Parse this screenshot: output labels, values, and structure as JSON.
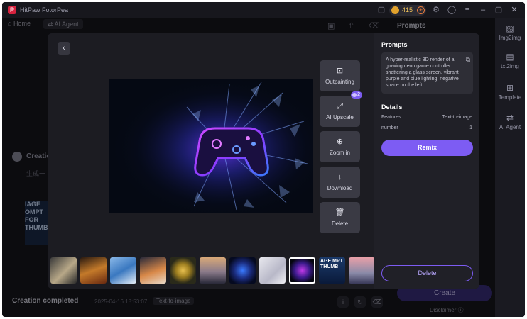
{
  "app": {
    "title": "HitPaw FotorPea",
    "credits": "415"
  },
  "background": {
    "home_label": "Home",
    "agent_label": "AI Agent",
    "prompts_title": "Prompts",
    "rail": [
      {
        "label": "Img2img"
      },
      {
        "label": "txt2img"
      },
      {
        "label": "Template"
      },
      {
        "label": "AI Agent"
      }
    ],
    "creation_title": "Creation",
    "creation_sub": "生成一",
    "bottom_title": "Creation completed",
    "bottom_meta": "2025-04-16 18:53:07",
    "bottom_tag": "Text-to-image",
    "create_label": "Create",
    "disclaimer_label": "Disclaimer"
  },
  "viewer": {
    "back_icon": "back-icon",
    "tools": [
      {
        "label": "Outpainting",
        "icon": "outpainting-icon"
      },
      {
        "label": "AI Upscale",
        "icon": "upscale-icon"
      },
      {
        "label": "Zoom in",
        "icon": "zoom-in-icon"
      },
      {
        "label": "Download",
        "icon": "download-icon"
      },
      {
        "label": "Delete",
        "icon": "trash-icon"
      }
    ],
    "upscale_badge": "2",
    "thumbnails": [
      {
        "style": "linear-gradient(135deg,#3a3a3a,#b8a888 55%,#2a2a2a)"
      },
      {
        "style": "linear-gradient(160deg,#2a1a10,#c47a2a 50%,#6a2a10)"
      },
      {
        "style": "linear-gradient(150deg,#8ab8e8,#3a78c0 50%,#e8f0f8)"
      },
      {
        "style": "linear-gradient(160deg,#2a2a3a,#d88848 55%,#e8d8c8)"
      },
      {
        "style": "radial-gradient(circle,#e8c050 0%,#a08020 35%,#2a2a1a 70%)"
      },
      {
        "style": "linear-gradient(180deg,#d8a878,#8a7a8a 55%,#2a2a3a)"
      },
      {
        "style": "radial-gradient(circle,#3a7aff 0%,#1a2a7a 45%,#050a20 80%)"
      },
      {
        "style": "linear-gradient(135deg,#e8e8ee,#b8b8c8 60%,#f0f0f4)"
      },
      {
        "style": "radial-gradient(circle,#c03ae8 0%,#3a1a8a 45%,#05060f 80%)",
        "selected": true
      },
      {
        "style": "linear-gradient(180deg,#1b3a6a,#0a1a3a)",
        "text": "AGE MPT THUMB"
      },
      {
        "style": "linear-gradient(180deg,#e8a0a8,#8a8aa8 60%,#3a3a5a)"
      }
    ]
  },
  "panel": {
    "prompts_title": "Prompts",
    "prompt_text": "A hyper-realistic 3D render of a glowing neon game controller shattering a glass screen, vibrant purple and blue lighting, negative space on the left.",
    "details_title": "Details",
    "features_label": "Features",
    "features_value": "Text-to-image",
    "number_label": "number",
    "number_value": "1",
    "remix_label": "Remix",
    "delete_label": "Delete"
  },
  "colors": {
    "accent": "#7d5cf3",
    "background": "#16161c",
    "panel": "#202027"
  }
}
